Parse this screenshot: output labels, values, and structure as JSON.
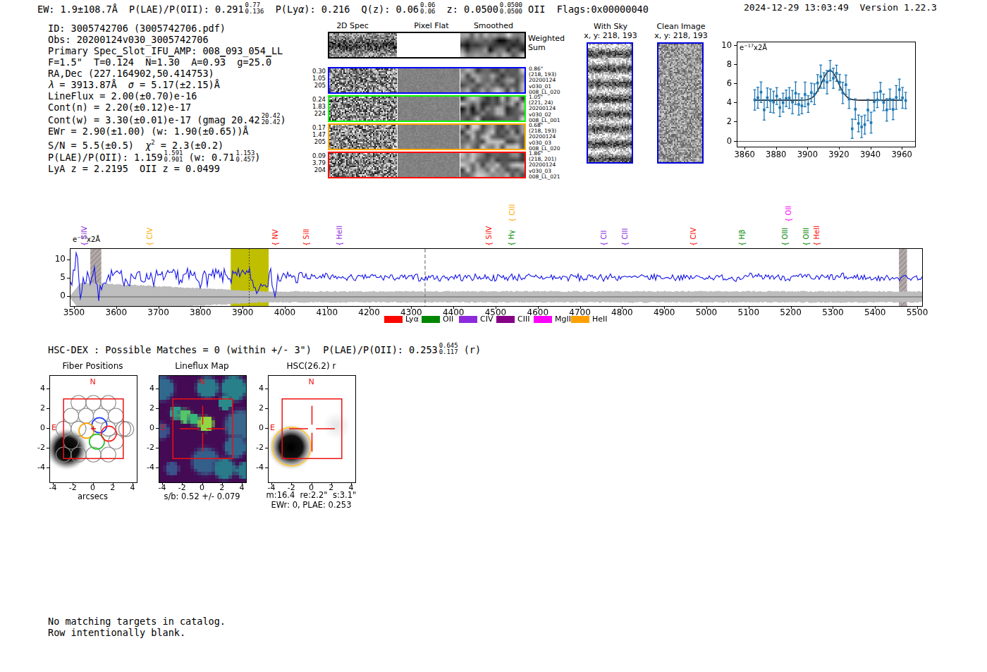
{
  "header": {
    "segments": [
      {
        "t": "EW: 1.9±108.7Å  P(LAE)/P(OII): 0.291"
      },
      {
        "sup": "0.77",
        "sub": "0.136"
      },
      {
        "t": "  P(Ly"
      },
      {
        "t": "α",
        "it": 1
      },
      {
        "t": "): 0.216  Q(z): 0.06"
      },
      {
        "sup": "0.06",
        "sub": "0.06"
      },
      {
        "t": "  z: 0.0500"
      },
      {
        "sup": "0.0500",
        "sub": "0.0500"
      },
      {
        "t": " OII  Flags:0x00000040"
      }
    ],
    "timestamp": "2024-12-29 13:03:49",
    "version": "Version 1.22.3"
  },
  "info_lines": [
    [
      {
        "t": "ID: 3005742706 (3005742706.pdf)"
      }
    ],
    [
      {
        "t": "Obs: 20200124v030_3005742706"
      }
    ],
    [
      {
        "t": "Primary Spec_Slot_IFU_AMP: 008_093_054_LL"
      }
    ],
    [
      {
        "t": "F=1.5\"  T=0."
      },
      {
        "t": "1",
        "ov": 1
      },
      {
        "t": "24  N=1."
      },
      {
        "t": "3",
        "ov": 1
      },
      {
        "t": "0  A=0.9"
      },
      {
        "t": "3",
        "ov": 1
      },
      {
        "t": "  g=25."
      },
      {
        "t": "0",
        "ov": 1
      }
    ],
    [
      {
        "t": "RA,Dec (227.164902,50.414753)"
      }
    ],
    [
      {
        "t": "λ",
        "it": 1
      },
      {
        "t": " = 3913.87Å  "
      },
      {
        "t": "σ",
        "it": 1
      },
      {
        "t": " = 5.17(±2.15)Å"
      }
    ],
    [
      {
        "t": "LineFlux = 2.00(±0.70)e-16"
      }
    ],
    [
      {
        "t": "Cont(n) = 2.20(±0.12)e-17"
      }
    ],
    [
      {
        "t": "Cont(w) = 3.30(±0.01)e-17 (gmag 20.42"
      },
      {
        "sup": "20.42",
        "sub": "20.42"
      },
      {
        "t": ")"
      }
    ],
    [
      {
        "t": "EWr = 2.90(±1.00) (w: 1.90(±0.65))Å"
      }
    ],
    [
      {
        "t": "S/N = 5.5(±0.5)  "
      },
      {
        "t": "χ",
        "it": 1
      },
      {
        "sup2": "2"
      },
      {
        "t": " = 2.3(±0.2)"
      }
    ],
    [
      {
        "t": "P(LAE)/P(OII): 1.159"
      },
      {
        "sup": "1.591",
        "sub": "0.901"
      },
      {
        "t": " (w: 0.71"
      },
      {
        "sup": "1.153",
        "sub": "0.457"
      },
      {
        "t": ")"
      }
    ],
    [
      {
        "t": "LyA z = 2.2195  OII z = 0.0499"
      }
    ]
  ],
  "spec2d": {
    "titles": [
      "2D Spec",
      "Pixel Flat",
      "Smoothed"
    ],
    "weighted_label": [
      "Weighted",
      "Sum"
    ],
    "rows": [
      {
        "color": "#0408ff",
        "left": [
          "0.30",
          "1.05",
          "205"
        ],
        "right": [
          "0.86\"",
          "(218, 193)",
          "20200124",
          "v030_01",
          "008_LL_020"
        ]
      },
      {
        "color": "#0aff03",
        "left": [
          "0.24",
          "1.83",
          "224"
        ],
        "right": [
          "1.05\"",
          "(221, 24)",
          "20200124",
          "v030_02",
          "008_LL_001"
        ]
      },
      {
        "color": "#feac00",
        "left": [
          "0.17",
          "1.47",
          "205"
        ],
        "right": [
          "0.68\"",
          "(218, 193)",
          "20200124",
          "v030_03",
          "008_LL_020"
        ]
      },
      {
        "color": "#ff0600",
        "left": [
          "0.09",
          "3.79",
          "204"
        ],
        "right": [
          "1.86\"",
          "(218, 201)",
          "20200124",
          "v030_03",
          "008_LL_021"
        ]
      }
    ]
  },
  "cutouts": {
    "border": "#0101dd",
    "withsky": {
      "title": "With Sky",
      "xy": "x, y: 218, 193"
    },
    "clean": {
      "title": "Clean Image",
      "xy": "x, y: 218, 193"
    }
  },
  "hsc_line": [
    {
      "t": "HSC-DEX : Possible Matches = 0 (within +/- 3\")  P(LAE)/P(OII): 0.253"
    },
    {
      "sup": "0.645",
      "sub": "0.117"
    },
    {
      "t": " (r)"
    }
  ],
  "footer_lines": [
    "No matching targets in catalog.",
    "Row intentionally blank."
  ],
  "chart_data": [
    {
      "name": "line-fit-zoom",
      "type": "scatter",
      "ylabel_inside": "e−17x2Å",
      "xlim": [
        3855,
        3968
      ],
      "ylim": [
        -0.55,
        10.35
      ],
      "xticks": [
        3860,
        3880,
        3900,
        3920,
        3940,
        3960
      ],
      "yticks": [
        0,
        2,
        4,
        6,
        8,
        10
      ],
      "point_color": "#1f77b4",
      "curve_color": "#2a2a2a",
      "fit": {
        "base": 4.3,
        "amp": 3.1,
        "mu": 3913.87,
        "sigma": 5.17
      },
      "points_model": {
        "x0": 3866,
        "x1": 3962,
        "step": 2,
        "noise": 1.2,
        "err": 1.0,
        "dip": {
          "x0": 3927,
          "x1": 3941,
          "delta": -2.2
        },
        "seed": 11
      }
    },
    {
      "name": "full-spectrum",
      "type": "line",
      "ylabel_inside": "e−17x2Å",
      "xlim": [
        3490,
        5510
      ],
      "ylim": [
        -2.51,
        13.15
      ],
      "xticks": [
        3500,
        3600,
        3700,
        3800,
        3900,
        4000,
        4100,
        4200,
        4300,
        4400,
        4500,
        4600,
        4700,
        4800,
        4900,
        5000,
        5100,
        5200,
        5300,
        5400,
        5500
      ],
      "yticks": [
        0,
        5,
        10
      ],
      "line_color": "#1515e8",
      "highlight_band": {
        "x0": 3870,
        "x1": 3960,
        "color": "#bfbf00"
      },
      "dotted_line_x": 3913.87,
      "dashed_line_x": 4331,
      "hatch_bands": [
        [
          3537,
          3563
        ],
        [
          5455,
          5474
        ]
      ],
      "error_band": {
        "halfwidth": 1.5,
        "left_extra": 2.6,
        "left_taper_start": 3950,
        "color": "#bdbdbd"
      },
      "spectrum_model": {
        "base": 5.32,
        "seed": 7,
        "sigma_left": 1.9,
        "sigma_right": 0.8,
        "features": [
          {
            "mu": 3905,
            "amp": 1.3,
            "sig": 8
          },
          {
            "mu": 3931,
            "amp": -2.9,
            "sig": 8
          },
          {
            "mu": 3975,
            "amp": -4.2,
            "sig": 3
          },
          {
            "mu": 3505,
            "amp": 7.0,
            "sig": 2.5
          },
          {
            "mu": 3514,
            "amp": -5.5,
            "sig": 2.5
          },
          {
            "mu": 3545,
            "amp": 3.0,
            "sig": 3
          },
          {
            "mu": 3557,
            "amp": -5.0,
            "sig": 4
          }
        ]
      },
      "line_markers": [
        {
          "label": "SiIV",
          "color": "#8d2add",
          "wave": 3545,
          "row": 0
        },
        {
          "label": "CIV",
          "color": "#feac00",
          "wave": 3700,
          "row": 0
        },
        {
          "label": "NV",
          "color": "#fa0800",
          "wave": 3998,
          "row": 0
        },
        {
          "label": "SiII",
          "color": "#fa0800",
          "wave": 4072,
          "row": 0
        },
        {
          "label": "HeII",
          "color": "#8d2add",
          "wave": 4150,
          "row": 0
        },
        {
          "label": "SiIV",
          "color": "#fa0800",
          "wave": 4505,
          "row": 0
        },
        {
          "label": "Hγ",
          "color": "#008601",
          "wave": 4558,
          "row": 0
        },
        {
          "label": "CIII",
          "color": "#feac00",
          "wave": 4560,
          "row": 1
        },
        {
          "label": "CII",
          "color": "#8d2add",
          "wave": 4778,
          "row": 0
        },
        {
          "label": "CIII",
          "color": "#8d2add",
          "wave": 4828,
          "row": 0
        },
        {
          "label": "CIV",
          "color": "#fa0800",
          "wave": 4990,
          "row": 0
        },
        {
          "label": "Hβ",
          "color": "#008601",
          "wave": 5105,
          "row": 0
        },
        {
          "label": "OIII",
          "color": "#008601",
          "wave": 5208,
          "row": 0
        },
        {
          "label": "OII",
          "color": "#ff00f8",
          "wave": 5215,
          "row": 1
        },
        {
          "label": "OIII",
          "color": "#008601",
          "wave": 5258,
          "row": 0
        },
        {
          "label": "HeII",
          "color": "#fa0800",
          "wave": 5283,
          "row": 0
        }
      ],
      "legend": [
        {
          "label": "Lyα",
          "color": "#fa0800"
        },
        {
          "label": "OII",
          "color": "#008601"
        },
        {
          "label": "CIV",
          "color": "#8d2add"
        },
        {
          "label": "CIII",
          "color": "#860085"
        },
        {
          "label": "MgII",
          "color": "#ff00f8"
        },
        {
          "label": "HeII",
          "color": "#ffa000"
        }
      ]
    },
    {
      "name": "fiber-positions",
      "type": "scatter",
      "title": "Fiber Positions",
      "xlabel": "arcsecs",
      "xticks": [
        -4,
        -2,
        0,
        2,
        4
      ],
      "yticks": [
        4,
        2,
        0,
        -2,
        -4
      ],
      "square_extent": 3,
      "compass": {
        "n": "N",
        "e": "E"
      },
      "fiber_radius": 0.755,
      "fiber_rows": [
        {
          "y": 2.6,
          "xs": [
            -1.5,
            0,
            1.5
          ]
        },
        {
          "y": 1.3,
          "xs": [
            -2.25,
            -0.75,
            0.75,
            2.25
          ]
        },
        {
          "y": 0.0,
          "xs": [
            -3.0,
            -1.5,
            1.5,
            3.0
          ]
        },
        {
          "y": -1.3,
          "xs": [
            -2.25,
            2.25
          ]
        },
        {
          "y": -2.6,
          "xs": [
            -3.0,
            -1.5,
            0,
            1.5
          ]
        },
        {
          "y": -0.05,
          "xs": [
            3.3
          ]
        }
      ],
      "colored_fibers": [
        {
          "x": 0.6,
          "y": 0.35,
          "color": "#1f3cff"
        },
        {
          "x": -0.7,
          "y": -0.2,
          "color": "#ffa500"
        },
        {
          "x": 0.35,
          "y": -1.3,
          "color": "#22c32a"
        },
        {
          "x": 1.55,
          "y": -0.5,
          "color": "#ff2020"
        }
      ],
      "blob": {
        "x": -2.65,
        "y": -2.05
      }
    },
    {
      "name": "lineflux-map",
      "type": "heatmap",
      "title": "Lineflux Map",
      "caption": "s/b: 0.52 +/- 0.079",
      "xticks": [
        -4,
        -2,
        0,
        2,
        4
      ],
      "yticks": [
        4,
        2,
        0,
        -2,
        -4
      ],
      "square_extent": 3,
      "compass": {
        "n": "N",
        "e": "E"
      },
      "base_color": "#440a54",
      "blobs": [
        {
          "x": -2.9,
          "y": 1.8,
          "r": 1.0,
          "color": "#2a9d8a"
        },
        {
          "x": -1.9,
          "y": 1.45,
          "r": 1.05,
          "color": "#54c568"
        },
        {
          "x": -0.9,
          "y": 1.05,
          "r": 0.85,
          "color": "#35b779"
        },
        {
          "x": 0.35,
          "y": 0.6,
          "r": 1.1,
          "color": "#90d743"
        },
        {
          "x": 4.2,
          "y": 0.4,
          "r": 2.3,
          "color": "#39688c"
        },
        {
          "x": 3.6,
          "y": -2.0,
          "r": 1.6,
          "color": "#31688e"
        },
        {
          "x": 0.3,
          "y": -3.6,
          "r": 2.0,
          "color": "#345f8b"
        },
        {
          "x": 2.4,
          "y": -4.4,
          "r": 1.6,
          "color": "#2a7a8b"
        },
        {
          "x": -4.5,
          "y": 4.5,
          "r": 1.8,
          "color": "#31688e"
        },
        {
          "x": 0.5,
          "y": 4.6,
          "r": 1.6,
          "color": "#2a7a8b"
        },
        {
          "x": 3.4,
          "y": 4.5,
          "r": 1.9,
          "color": "#27808a"
        },
        {
          "x": -4.6,
          "y": -0.2,
          "r": 1.2,
          "color": "#3b528b"
        },
        {
          "x": 2.5,
          "y": 2.9,
          "r": 1.0,
          "color": "#2a8a8a"
        },
        {
          "x": 4.6,
          "y": -4.6,
          "r": 1.2,
          "color": "#2a7a8b"
        },
        {
          "x": -3.4,
          "y": -4.4,
          "r": 1.0,
          "color": "#3b528b"
        }
      ]
    },
    {
      "name": "hsc-cutout",
      "type": "image",
      "title": "HSC(26.2) r",
      "caption1": "m:16.4  re:2.2\"  s:3.1\"",
      "caption2": "EWr: 0, PLAE: 0.253",
      "xticks": [
        -4,
        -2,
        0,
        2,
        4
      ],
      "yticks": [
        4,
        2,
        0,
        -2,
        -4
      ],
      "square_extent": 3,
      "compass": {
        "n": "N",
        "e": "E"
      },
      "blob": {
        "x": -2.1,
        "y": -1.85
      },
      "ring": {
        "x": -2.05,
        "y": -1.8,
        "r": 1.95,
        "color": "#ffc938"
      }
    }
  ]
}
